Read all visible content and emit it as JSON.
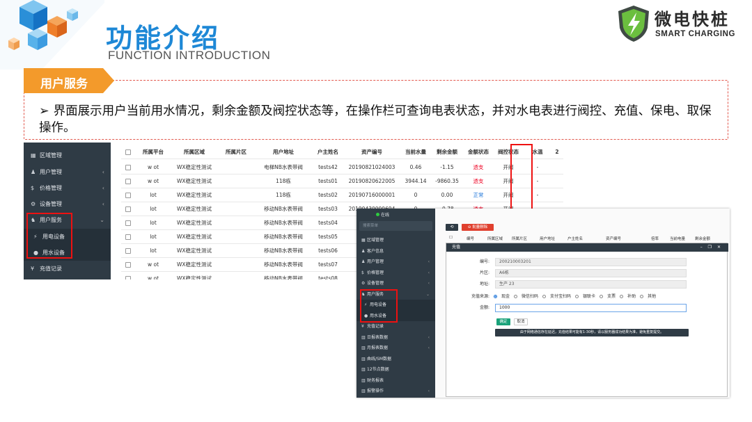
{
  "header": {
    "title_cn": "功能介绍",
    "title_en": "FUNCTION INTRODUCTION"
  },
  "logo": {
    "name_cn": "微电快桩",
    "name_en": "SMART CHARGING"
  },
  "section": {
    "tag": "用户服务",
    "description": "界面展示用户当前用水情况，剩余金额及阀控状态等，在操作栏可查询电表状态，并对水电表进行阀控、充值、保电、取保操作。"
  },
  "colors": {
    "accent_blue": "#1e88d6",
    "tag_orange": "#f39a2b",
    "sidebar_dark": "#2f3b45",
    "highlight_red": "#e11111"
  },
  "screenshot1": {
    "sidebar": [
      {
        "icon": "home-icon",
        "glyph": "▦",
        "label": "区域管理",
        "caret": ""
      },
      {
        "icon": "user-icon",
        "glyph": "♟",
        "label": "用户管理",
        "caret": "‹"
      },
      {
        "icon": "price-icon",
        "glyph": "$",
        "label": "价格管理",
        "caret": "‹"
      },
      {
        "icon": "device-icon",
        "glyph": "⚙",
        "label": "设备管理",
        "caret": "‹"
      },
      {
        "icon": "users-icon",
        "glyph": "♞",
        "label": "用户服务",
        "caret": "⌄"
      },
      {
        "icon": "electric-icon",
        "glyph": "⚡",
        "label": "用电设备",
        "caret": ""
      },
      {
        "icon": "water-icon",
        "glyph": "●",
        "label": "用水设备",
        "caret": ""
      },
      {
        "icon": "yen-icon",
        "glyph": "¥",
        "label": "充值记录",
        "caret": ""
      }
    ],
    "columns": [
      "",
      "所属平台",
      "所属区域",
      "所属片区",
      "用户地址",
      "户主姓名",
      "资产编号",
      "当前水量",
      "剩余金额",
      "金额状态",
      "阀控状态",
      "水温",
      "2"
    ],
    "rows": [
      [
        "",
        "w    ot",
        "WX稳定性测试",
        "",
        "电梯NB水表带阀",
        "tests42",
        "20190821024003",
        "0.46",
        "-1.15",
        "透支",
        "开阀",
        "-"
      ],
      [
        "",
        "w    ot",
        "WX稳定性测试",
        "",
        "118栋",
        "tests01",
        "20190820622005",
        "3944.14",
        "-9860.35",
        "透支",
        "开阀",
        "-"
      ],
      [
        "",
        "     lot",
        "WX稳定性测试",
        "",
        "118栋",
        "tests02",
        "20190716000001",
        "0",
        "0.00",
        "正常",
        "开阀",
        "-"
      ],
      [
        "",
        "     lot",
        "WX稳定性测试",
        "",
        "移动NB水表带阀",
        "tests03",
        "20190430000694",
        "0",
        "-0.78",
        "透支",
        "开阀",
        ""
      ],
      [
        "",
        "     lot",
        "WX稳定性测试",
        "",
        "移动NB水表带阀",
        "tests04",
        "",
        "",
        "",
        "",
        "",
        ""
      ],
      [
        "",
        "     lot",
        "WX稳定性测试",
        "",
        "移动NB水表带阀",
        "tests05",
        "",
        "",
        "",
        "",
        "",
        ""
      ],
      [
        "",
        "     lot",
        "WX稳定性测试",
        "",
        "移动NB水表带阀",
        "tests06",
        "",
        "",
        "",
        "",
        "",
        ""
      ],
      [
        "",
        "w    ot",
        "WX稳定性测试",
        "",
        "移动NB水表带阀",
        "tests07",
        "",
        "",
        "",
        "",
        "",
        ""
      ],
      [
        "",
        "w    ot",
        "WX稳定性测试",
        "",
        "移动NB水表带阀",
        "tests08",
        "",
        "",
        "",
        "",
        "",
        ""
      ]
    ]
  },
  "screenshot2": {
    "online": "在线",
    "search_placeholder": "搜索菜单",
    "sidebar": [
      {
        "icon": "home-icon",
        "glyph": "▦",
        "label": "区域管理",
        "caret": ""
      },
      {
        "icon": "user-icon",
        "glyph": "♟",
        "label": "客户信息",
        "caret": ""
      },
      {
        "icon": "user-icon",
        "glyph": "♟",
        "label": "用户管理",
        "caret": "‹"
      },
      {
        "icon": "price-icon",
        "glyph": "$",
        "label": "价格管理",
        "caret": "‹"
      },
      {
        "icon": "device-icon",
        "glyph": "⚙",
        "label": "设备管理",
        "caret": "‹"
      },
      {
        "icon": "users-icon",
        "glyph": "♞",
        "label": "用户服务",
        "caret": "⌄"
      },
      {
        "icon": "electric-icon",
        "glyph": "⚡",
        "label": "用电设备",
        "caret": ""
      },
      {
        "icon": "water-icon",
        "glyph": "●",
        "label": "用水设备",
        "caret": ""
      },
      {
        "icon": "yen-icon",
        "glyph": "¥",
        "label": "充值记录",
        "caret": ""
      },
      {
        "icon": "chart-icon",
        "glyph": "▥",
        "label": "日报表数据",
        "caret": "‹"
      },
      {
        "icon": "chart-icon",
        "glyph": "▥",
        "label": "月报表数据",
        "caret": "‹"
      },
      {
        "icon": "chart-icon",
        "glyph": "▥",
        "label": "曲线/SM数据",
        "caret": ""
      },
      {
        "icon": "chart-icon",
        "glyph": "▥",
        "label": "12节点数据",
        "caret": ""
      },
      {
        "icon": "chart-icon",
        "glyph": "▥",
        "label": "财务报表",
        "caret": ""
      },
      {
        "icon": "chart-icon",
        "glyph": "▥",
        "label": "报警操作",
        "caret": "‹"
      }
    ],
    "toolbar": {
      "refresh": "⟲",
      "delete": "⊖ 批量删除"
    },
    "columns": [
      "",
      "编号",
      "所属区域",
      "所属片区",
      "用户地址",
      "户主姓名",
      "资产编号",
      "倍率",
      "当前电量",
      "剩余金额"
    ],
    "dialog": {
      "title": "充值",
      "controls": "– ❐ ✕",
      "fields": [
        {
          "label": "编号:",
          "value": "200210003201"
        },
        {
          "label": "片区:",
          "value": "A6栋"
        },
        {
          "label": "地址:",
          "value": "生产 23"
        }
      ],
      "source_label": "充值来源:",
      "sources": [
        "现金",
        "微信扫码",
        "支付宝扫码",
        "银联卡",
        "支票",
        "补助",
        "其他"
      ],
      "source_selected": "现金",
      "amount_label": "金额:",
      "amount_value": "1000",
      "confirm": "确定",
      "cancel": "取消",
      "tip": "由于网络通信存在延迟，充值结果可能有1-30秒，请以服务器成功结果为准，避免重复提交。"
    }
  }
}
